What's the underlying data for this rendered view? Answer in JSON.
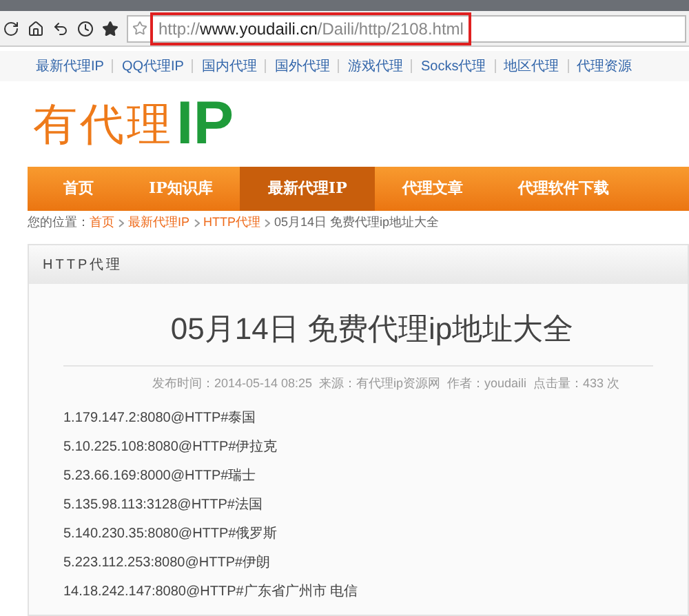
{
  "browser": {
    "address_scheme": "http://",
    "address_domain": "www.youdaili.cn",
    "address_path": "/Daili/http/2108.html",
    "address_highlighted": true
  },
  "top_links": [
    "最新代理IP",
    "QQ代理IP",
    "国内代理",
    "国外代理",
    "游戏代理",
    "Socks代理",
    "地区代理",
    "代理资源"
  ],
  "logo": {
    "text": "有代理",
    "accent": "IP"
  },
  "nav": [
    {
      "label": "首页",
      "selected": false
    },
    {
      "label": "IP知识库",
      "selected": false
    },
    {
      "label": "最新代理IP",
      "selected": true
    },
    {
      "label": "代理文章",
      "selected": false
    },
    {
      "label": "代理软件下载",
      "selected": false
    }
  ],
  "breadcrumb": {
    "prefix": "您的位置：",
    "links": [
      "首页",
      "最新代理IP",
      "HTTP代理"
    ],
    "current": "05月14日 免费代理ip地址大全"
  },
  "panel": {
    "heading": "HTTP代理",
    "title": "05月14日 免费代理ip地址大全",
    "meta": "发布时间：2014-05-14 08:25  来源：有代理ip资源网  作者：youdaili  点击量：433 次",
    "lines": [
      "1.179.147.2:8080@HTTP#泰国",
      "5.10.225.108:8080@HTTP#伊拉克",
      "5.23.66.169:8000@HTTP#瑞士",
      "5.135.98.113:3128@HTTP#法国",
      "5.140.230.35:8080@HTTP#俄罗斯",
      "5.223.112.253:8080@HTTP#伊朗",
      "14.18.242.147:8080@HTTP#广东省广州市 电信"
    ]
  }
}
